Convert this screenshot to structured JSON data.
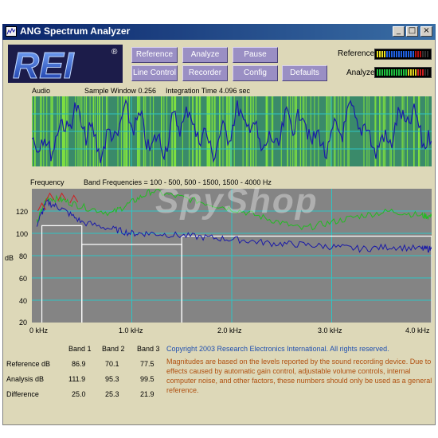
{
  "window": {
    "title": "ANG Spectrum Analyzer",
    "minimize": "_",
    "maximize": "□",
    "close": "×"
  },
  "logo": {
    "text": "REI",
    "registered": "®"
  },
  "toolbar": {
    "reference": "Reference",
    "analyze": "Analyze",
    "pause": "Pause",
    "line_control": "Line Control",
    "recorder": "Recorder",
    "config": "Config",
    "defaults": "Defaults"
  },
  "meters": {
    "reference_label": "Reference",
    "analyze_label": "Analyze"
  },
  "audio": {
    "label": "Audio",
    "sample_window": "Sample Window 0.256",
    "integration_time": "Integration Time 4.096 sec"
  },
  "frequency": {
    "label": "Frequency",
    "bands_caption": "Band Frequencies = 100 - 500, 500 - 1500, 1500 - 4000 Hz",
    "y_unit": "dB",
    "y_ticks": [
      "120",
      "100",
      "80",
      "60",
      "40",
      "20",
      "0"
    ],
    "x_ticks": [
      "0 kHz",
      "1.0 kHz",
      "2.0 kHz",
      "3.0 kHz",
      "4.0 kHz"
    ]
  },
  "chart_data": {
    "type": "line",
    "xlabel": "",
    "ylabel": "dB",
    "xlim": [
      0,
      4.0
    ],
    "ylim": [
      0,
      120
    ],
    "grid": true,
    "series": [
      {
        "name": "",
        "color": "#22bb22",
        "x": [
          0.05,
          0.15,
          0.3,
          0.5,
          0.8,
          1.0,
          1.2,
          1.5,
          1.8,
          2.1,
          2.4,
          2.7,
          3.0,
          3.3,
          3.6,
          3.9,
          4.0
        ],
        "values": [
          90,
          112,
          110,
          104,
          98,
          108,
          118,
          112,
          106,
          100,
          92,
          84,
          90,
          96,
          100,
          96,
          95
        ]
      },
      {
        "name": "",
        "color": "#1a1aa8",
        "x": [
          0.05,
          0.15,
          0.3,
          0.5,
          0.8,
          1.0,
          1.2,
          1.5,
          1.8,
          2.1,
          2.4,
          2.7,
          3.0,
          3.3,
          3.6,
          3.9,
          4.0
        ],
        "values": [
          88,
          108,
          102,
          90,
          84,
          80,
          80,
          78,
          76,
          74,
          71,
          70,
          68,
          66,
          68,
          66,
          66
        ]
      },
      {
        "name": "Band levels",
        "color": "#ffffff",
        "x_ranges": [
          [
            0.1,
            0.5
          ],
          [
            0.5,
            1.5
          ],
          [
            1.5,
            4.0
          ]
        ],
        "values": [
          86.9,
          70.1,
          77.5
        ]
      }
    ]
  },
  "stats": {
    "headers": [
      "Band 1",
      "Band 2",
      "Band 3"
    ],
    "rows": [
      {
        "label": "Reference dB",
        "values": [
          "86.9",
          "70.1",
          "77.5"
        ]
      },
      {
        "label": "Analysis dB",
        "values": [
          "111.9",
          "95.3",
          "99.5"
        ]
      },
      {
        "label": "Difference",
        "values": [
          "25.0",
          "25.3",
          "21.9"
        ]
      }
    ]
  },
  "copyright": "Copyright 2003  Research Electronics International.  All rights reserved.",
  "note": "Magnitudes are based on the levels reported by the sound recording device. Due to effects caused by automatic gain control, adjustable volume controls, internal computer noise, and other factors, these numbers should only be used as a general reference.",
  "watermark": "SpyShop",
  "colors": {
    "accent": "#9a8fc4",
    "panel_bg": "#ddd8b8",
    "grid": "#2ec4c4",
    "reference": "#22bb22",
    "analysis": "#1a1aa8"
  }
}
